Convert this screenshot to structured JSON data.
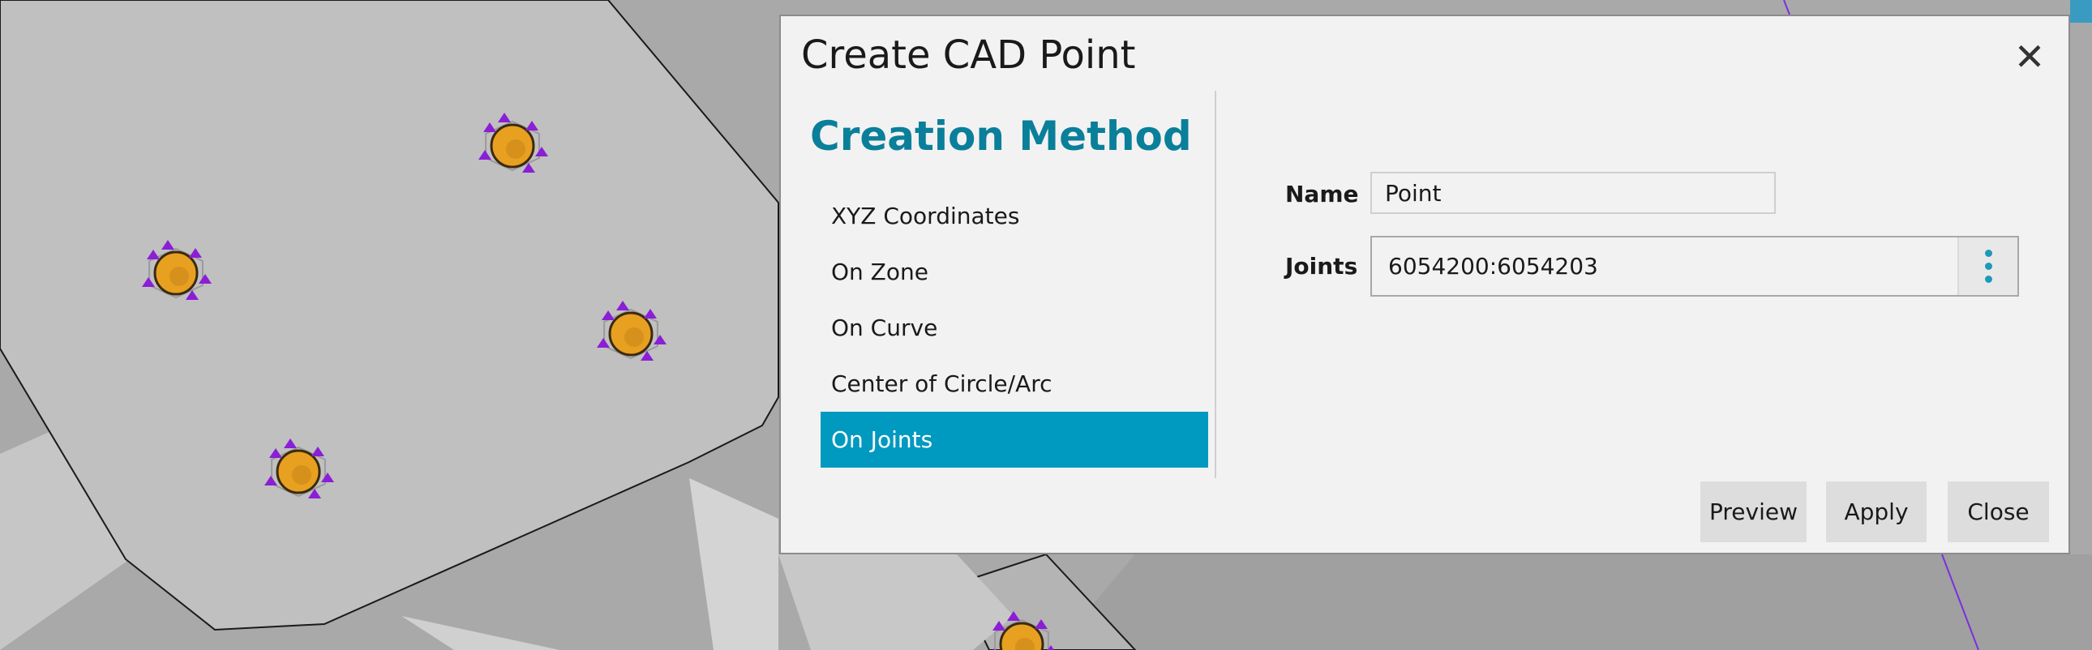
{
  "dialog": {
    "title": "Create CAD Point",
    "close_glyph": "✕",
    "section_title": "Creation Method",
    "methods": [
      {
        "label": "XYZ Coordinates",
        "selected": false
      },
      {
        "label": "On Zone",
        "selected": false
      },
      {
        "label": "On Curve",
        "selected": false
      },
      {
        "label": "Center of Circle/Arc",
        "selected": false
      },
      {
        "label": "On Joints",
        "selected": true
      }
    ],
    "fields": {
      "name_label": "Name",
      "name_value": "Point",
      "joints_label": "Joints",
      "joints_value": "6054200:6054203"
    },
    "buttons": {
      "preview": "Preview",
      "apply": "Apply",
      "close": "Close"
    }
  },
  "colors": {
    "accent": "#0099bf",
    "section_title": "#0a7f9a",
    "joint_marker": "#e8a020",
    "joint_triad": "#8a1fd6"
  }
}
